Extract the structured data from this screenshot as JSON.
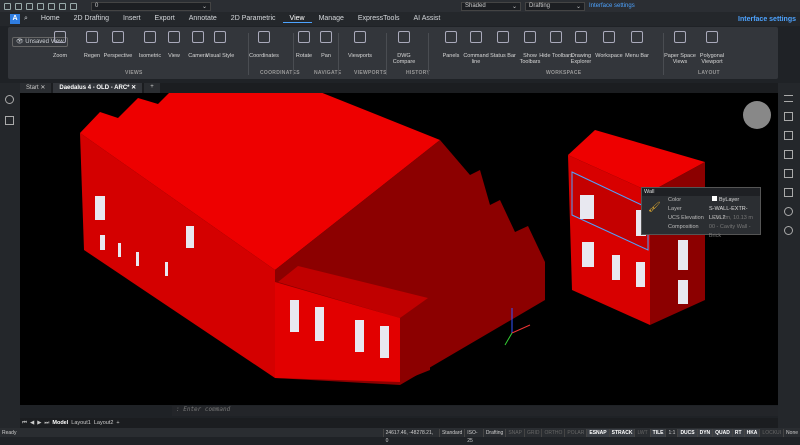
{
  "quick_access": {
    "layer_value": "0",
    "visual_style": "Shaded",
    "workspace": "Drafting",
    "interface_settings": "Interface settings"
  },
  "menu": {
    "items": [
      "Home",
      "2D Drafting",
      "Insert",
      "Export",
      "Annotate",
      "2D Parametric",
      "View",
      "Manage",
      "ExpressTools",
      "AI Assist"
    ],
    "active": "View",
    "interface_settings": "Interface settings"
  },
  "ribbon": {
    "unsaved_view": "Unsaved View",
    "tools": [
      {
        "label": "Zoom"
      },
      {
        "label": "Regen"
      },
      {
        "label": "Perspective"
      },
      {
        "label": "Isometric"
      },
      {
        "label": "View"
      },
      {
        "label": "Camera"
      },
      {
        "label": "Visual Style"
      },
      {
        "label": "Coordinates"
      },
      {
        "label": "Rotate"
      },
      {
        "label": "Pan"
      },
      {
        "label": "Viewports"
      },
      {
        "label": "DWG Compare"
      },
      {
        "label": "Panels"
      },
      {
        "label": "Command line"
      },
      {
        "label": "Status Bar"
      },
      {
        "label": "Show Toolbars"
      },
      {
        "label": "Hide Toolbars"
      },
      {
        "label": "Drawing Explorer"
      },
      {
        "label": "Workspace"
      },
      {
        "label": "Menu Bar"
      },
      {
        "label": "Paper Space Views"
      },
      {
        "label": "Polygonal Viewport"
      }
    ],
    "groups": [
      "VIEWS",
      "COORDINATES",
      "NAVIGATE",
      "VIEWPORTS",
      "HISTORY",
      "WORKSPACE",
      "LAYOUT"
    ]
  },
  "doc_tabs": [
    "Start",
    "Daedalus 4 - OLD - ARC*"
  ],
  "properties_panel": {
    "title": "Wall",
    "rows": [
      {
        "key": "Color",
        "value": "ByLayer"
      },
      {
        "key": "Layer",
        "value": "S-WALL-EXTR-LEVL2"
      },
      {
        "key": "UCS Elevation",
        "value": "625 cm, 10.13 m"
      },
      {
        "key": "Composition",
        "value": "00 - Cavity Wall - Brick"
      }
    ]
  },
  "command_line": {
    "placeholder": ": Enter command"
  },
  "layout_tabs": [
    "Model",
    "Layout1",
    "Layout2"
  ],
  "status": {
    "ready": "Ready",
    "coords": "24617.46, -48278.21, 0",
    "items": [
      {
        "t": "Standard",
        "s": "n"
      },
      {
        "t": "ISO-25",
        "s": "n"
      },
      {
        "t": "Drafting",
        "s": "n"
      },
      {
        "t": "SNAP",
        "s": "off"
      },
      {
        "t": "GRID",
        "s": "off"
      },
      {
        "t": "ORTHO",
        "s": "off"
      },
      {
        "t": "POLAR",
        "s": "off"
      },
      {
        "t": "ESNAP",
        "s": "on"
      },
      {
        "t": "STRACK",
        "s": "on"
      },
      {
        "t": "LWT",
        "s": "off"
      },
      {
        "t": "TILE",
        "s": "on"
      },
      {
        "t": "1:1",
        "s": "n"
      },
      {
        "t": "DUCS",
        "s": "on"
      },
      {
        "t": "DYN",
        "s": "on"
      },
      {
        "t": "QUAD",
        "s": "on"
      },
      {
        "t": "RT",
        "s": "on"
      },
      {
        "t": "HKA",
        "s": "on"
      },
      {
        "t": "LOCKUI",
        "s": "off"
      },
      {
        "t": "None",
        "s": "n"
      }
    ]
  },
  "colors": {
    "building": "#e00000",
    "building_dark": "#8c0000",
    "accent": "#4da3ff"
  }
}
